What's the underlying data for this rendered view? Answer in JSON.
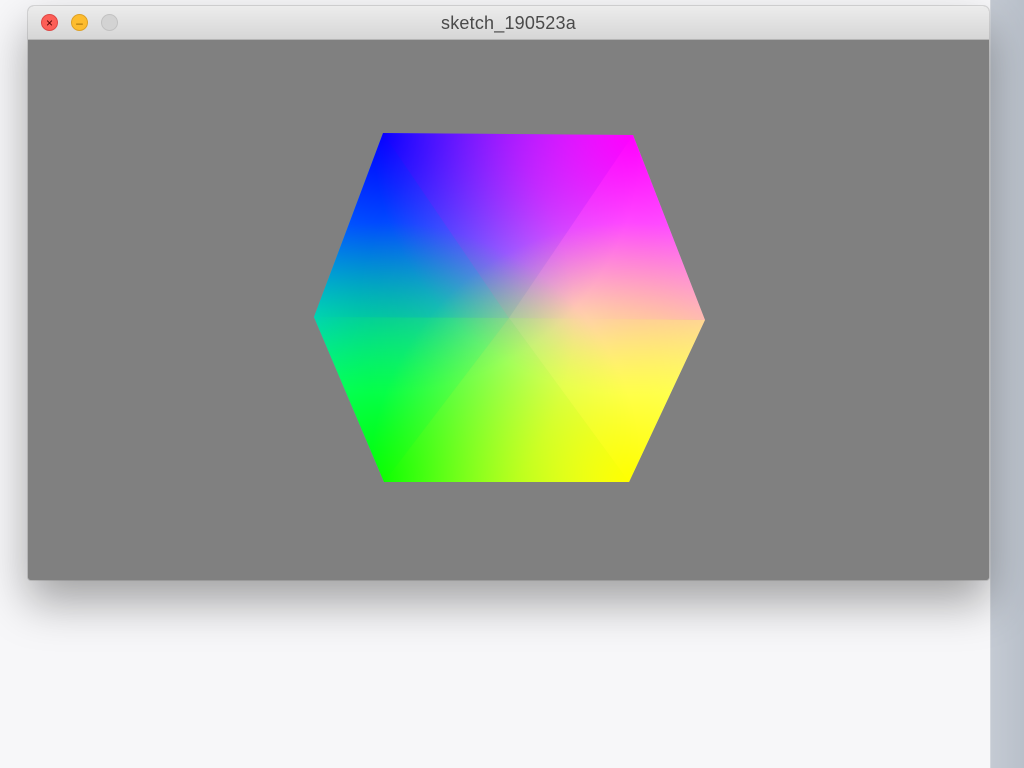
{
  "window": {
    "title": "sketch_190523a",
    "close_glyph": "×",
    "minimize_glyph": "–"
  },
  "canvas": {
    "background_color": "#808080",
    "shape": "hexagon",
    "colors": {
      "top_left": "#0000ff",
      "top_right": "#ff00ff",
      "left": "#00ffff",
      "center": "#ffffff",
      "right": "#ffffff",
      "bottom_left": "#00ff00",
      "bottom_right": "#ffff00"
    }
  },
  "icons": {
    "close": "close-icon",
    "minimize": "minimize-icon",
    "zoom": "zoom-icon"
  }
}
